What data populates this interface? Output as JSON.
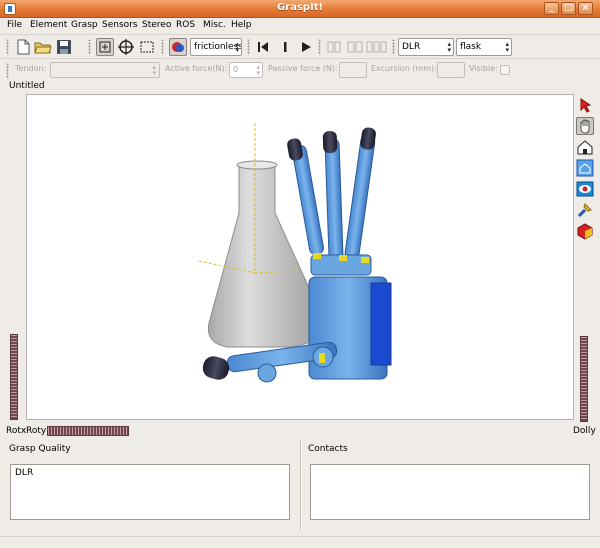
{
  "window": {
    "title": "GraspIt!"
  },
  "menu": [
    "File",
    "Element",
    "Grasp",
    "Sensors",
    "Stereo",
    "ROS",
    "Misc.",
    "Help"
  ],
  "toolbar1": {
    "material_value": "frictionless",
    "hand_value": "DLR",
    "object_value": "flask"
  },
  "toolbar2": {
    "tendon_label": "Tendon:",
    "active_force_label": "Active force(N):",
    "active_force_value": "0",
    "passive_force_label": "Passive force (N):",
    "excursion_label": "Excursion (mm):",
    "visible_label": "Visible:"
  },
  "document": {
    "tab": "Untitled"
  },
  "viewer": {
    "rotx_label": "Rotx",
    "roty_label": "Roty",
    "dolly_label": "Dolly"
  },
  "panels": {
    "grasp_quality": {
      "title": "Grasp Quality",
      "items": [
        "DLR"
      ]
    },
    "contacts": {
      "title": "Contacts",
      "items": []
    }
  },
  "icons": {
    "toolbar": [
      "new-file-icon",
      "open-folder-icon",
      "save-disk-icon",
      "translate-tool-icon",
      "rotate-tool-icon",
      "select-box-icon",
      "collision-icon",
      "skip-back-icon",
      "pause-icon",
      "play-icon"
    ],
    "viewer_side": [
      "pick-arrow-icon",
      "hand-icon",
      "home-icon",
      "set-home-icon",
      "view-all-icon",
      "seek-icon",
      "projection-icon"
    ]
  },
  "colors": {
    "titlebar": "#e47a34",
    "hand": "#5d9ee0",
    "flask": "#c8c8c8"
  }
}
